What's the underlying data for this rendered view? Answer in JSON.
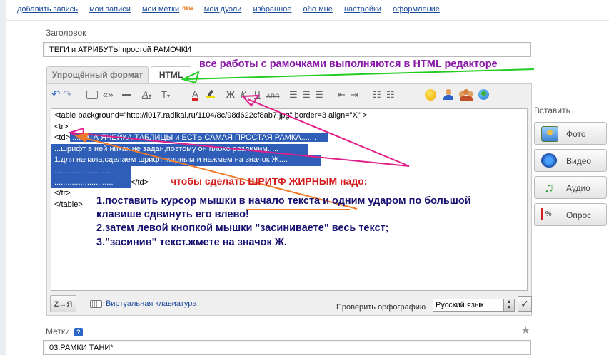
{
  "nav": {
    "items": [
      "добавить запись",
      "мои записи",
      "мои метки",
      "мои дуэли",
      "избранное",
      "обо мне",
      "настройки",
      "оформление"
    ],
    "new_badge": "new"
  },
  "title_field": {
    "label": "Заголовок",
    "value": "ТЕГИ и АТРИБУТЫ простой РАМОЧКИ"
  },
  "tabs": {
    "simple": "Упрощённый формат",
    "html": "HTML"
  },
  "toolbar": {
    "icons": [
      "undo-icon",
      "redo-icon",
      "quote-block-icon",
      "quotes-icon",
      "hr-icon",
      "font-icon",
      "font-size-icon",
      "text-color-icon",
      "highlight-icon",
      "bold-icon",
      "italic-icon",
      "underline-icon",
      "strike-icon",
      "align-left-icon",
      "align-center-icon",
      "align-right-icon",
      "outdent-icon",
      "indent-icon",
      "ordered-list-icon",
      "unordered-list-icon",
      "smiley-icon",
      "user-icon",
      "community-icon",
      "globe-icon"
    ],
    "quotes_glyph": "«»",
    "font_glyph": "A",
    "size_glyph": "T",
    "color_glyph": "A",
    "bold_glyph": "Ж",
    "italic_glyph": "К",
    "underline_glyph": "Ч",
    "strike_glyph": "ABC"
  },
  "editor": {
    "lines": [
      "<table background=\"http://i017.radikal.ru/1104/8c/98d622cf8ab7.jpg\" border=3 align=\"X\" >",
      "<tr>",
      "<td>",
      "......ЭТА ЯЧЕЙКА ТАБЛИЦЫ и ЕСТЬ САМАЯ ПРОСТАЯ РАМКА.......",
      "...шрифт в ней никак не задан,поэтому он плохо различим.....",
      "1.для начала,сделаем шрифт жирным и нажмем на значок Ж....",
      "..........................",
      "...........................",
      "</td>",
      "</tr>",
      "</table>"
    ]
  },
  "bottom": {
    "az_button": "Z→Я",
    "virtual_keyboard": "Виртуальная клавиатура",
    "spell_label": "Проверить орфографию",
    "language": "Русский язык",
    "check_glyph": "✓"
  },
  "insert": {
    "title": "Вставить",
    "buttons": [
      "Фото",
      "Видео",
      "Аудио",
      "Опрос"
    ]
  },
  "tags_field": {
    "label": "Метки",
    "help": "?",
    "value": "03.РАМКИ ТАНИ*"
  },
  "annotations": {
    "green_note": "все работы с рамочками выполняются в HTML редакторе",
    "red_note": "чтобы сделать ШРИТФ ЖИРНЫМ надо:",
    "steps": [
      "1.поставить курсор мышки в начало текста и одним ударом по большой",
      "клавише сдвинуть его влево!",
      "2.затем левой кнопкой мышки \"засиниваете\" весь текст;",
      "3.\"засинив\" текст.жмете на значок Ж."
    ]
  },
  "colors": {
    "link": "#1a4a9a",
    "green_note": "#8a1aa8",
    "red_note": "#d41a1a",
    "steps": "#16106e",
    "selection": "#2e5eb7",
    "arrow_green": "#22cc22",
    "arrow_magenta": "#e0208a",
    "arrow_orange": "#f07a2a"
  }
}
